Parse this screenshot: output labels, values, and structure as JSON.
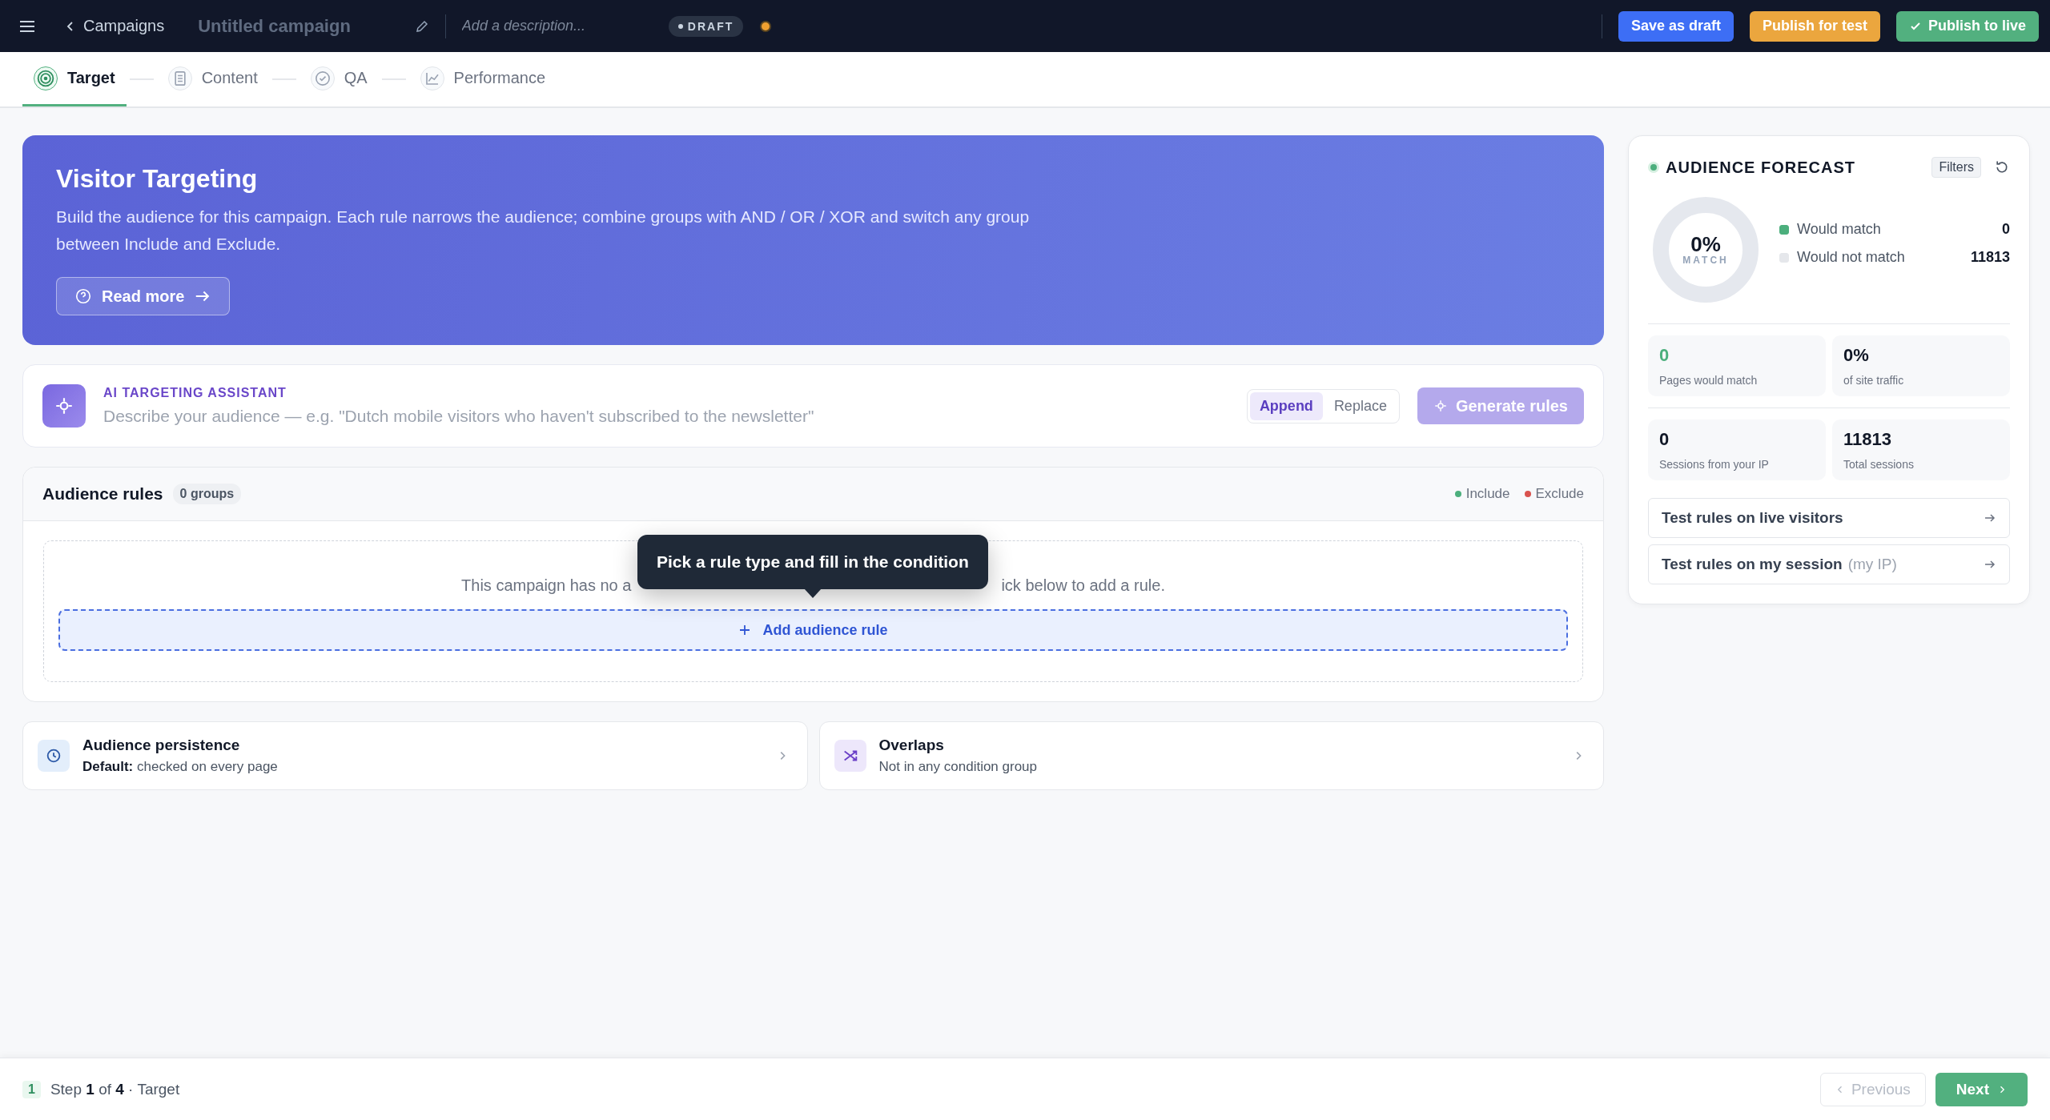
{
  "top_bar": {
    "back_label": "Campaigns",
    "title": "Untitled campaign",
    "description_placeholder": "Add a description...",
    "status": "DRAFT",
    "buttons": [
      {
        "label": "Save as draft",
        "kind": "primary"
      },
      {
        "label": "Publish for test",
        "kind": "warning"
      },
      {
        "label": "Publish to live",
        "kind": "success"
      }
    ]
  },
  "steps": [
    {
      "label": "Target",
      "selected": true
    },
    {
      "label": "Content",
      "selected": false
    },
    {
      "label": "QA",
      "selected": false
    },
    {
      "label": "Performance",
      "selected": false
    }
  ],
  "hero": {
    "title": "Visitor Targeting",
    "text": "Build the audience for this campaign. Each rule narrows the audience; combine groups with AND / OR / XOR and switch any group between Include and Exclude.",
    "button": "Read more"
  },
  "assistant": {
    "label": "AI TARGETING ASSISTANT",
    "placeholder": "Describe your audience — e.g. \"Dutch mobile visitors who haven't subscribed to the newsletter\"",
    "modes": [
      {
        "label": "Append",
        "selected": true
      },
      {
        "label": "Replace",
        "selected": false
      }
    ],
    "button": {
      "label": "Generate rules",
      "disabled": true
    }
  },
  "rules": {
    "title": "Audience rules",
    "count": "0 groups",
    "legend": [
      {
        "label": "Include",
        "color": "#4caf7d"
      },
      {
        "label": "Exclude",
        "color": "#d9534f"
      }
    ],
    "empty_text_start": "This campaign has no a",
    "empty_text_end": "ick below to add a rule.",
    "add_button": "Add audience rule",
    "tooltip": "Pick a rule type and fill in the condition"
  },
  "cards": [
    {
      "kind": "clock",
      "title": "Audience persistence",
      "subtitle": "**Default:** checked on every page"
    },
    {
      "kind": "shuffle",
      "title": "Overlaps",
      "subtitle": "Not in any condition group"
    }
  ],
  "forecast": {
    "title": "AUDIENCE FORECAST",
    "filters": "Filters",
    "percent": "0%",
    "percent_label": "MATCH",
    "level": 0,
    "legend": [
      {
        "label": "Would match",
        "value": "0",
        "color": "#4caf7d"
      },
      {
        "label": "Would not match",
        "value": "11813",
        "color": "#e5e7eb"
      }
    ],
    "stats": [
      {
        "kind": "positive",
        "value": "0",
        "label": "Pages would match"
      },
      {
        "kind": "plain",
        "value": "0%",
        "label": "of site traffic"
      },
      {
        "kind": "plain",
        "value": "0",
        "label": "Sessions from your IP"
      },
      {
        "kind": "plain",
        "value": "11813",
        "label": "Total sessions"
      }
    ],
    "links": [
      {
        "label": "Test rules on live visitors"
      },
      {
        "label": "Test rules on my session",
        "note": "(my IP)"
      }
    ]
  },
  "footer": {
    "step": "1",
    "text": "Step **1** of **4** · Target",
    "previous": {
      "label": "Previous",
      "disabled": true
    },
    "next": "Next"
  }
}
